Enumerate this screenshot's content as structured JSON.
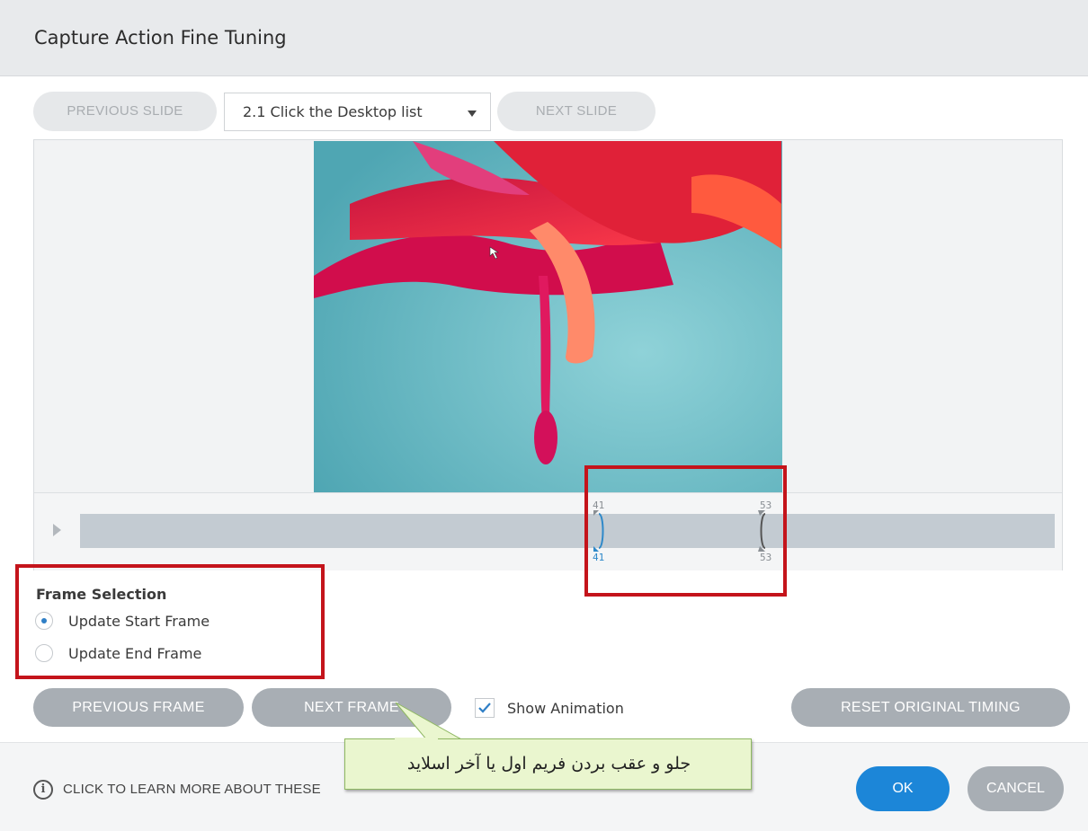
{
  "dialog": {
    "title": "Capture Action Fine Tuning"
  },
  "slide_nav": {
    "previous_label": "PREVIOUS SLIDE",
    "selected_slide": "2.1 Click the Desktop list",
    "next_label": "NEXT SLIDE"
  },
  "timeline": {
    "start_top": "41",
    "start_bottom": "41",
    "end_top": "53",
    "end_bottom": "53"
  },
  "frame_selection": {
    "title": "Frame Selection",
    "options": [
      {
        "label": "Update Start Frame",
        "selected": true
      },
      {
        "label": "Update End Frame",
        "selected": false
      }
    ]
  },
  "frame_buttons": {
    "previous_label": "PREVIOUS FRAME",
    "next_label": "NEXT FRAME",
    "show_animation_label": "Show Animation",
    "show_animation_checked": true,
    "reset_label": "RESET ORIGINAL TIMING"
  },
  "footer": {
    "learn_more": "CLICK TO LEARN MORE ABOUT THESE",
    "ok_label": "OK",
    "cancel_label": "CANCEL"
  },
  "callout": {
    "text": "جلو و عقب بردن فریم اول یا آخر اسلاید"
  },
  "colors": {
    "accent": "#1c86d8",
    "annotation_red": "#c4141b",
    "callout_bg": "#eaf6cf"
  }
}
